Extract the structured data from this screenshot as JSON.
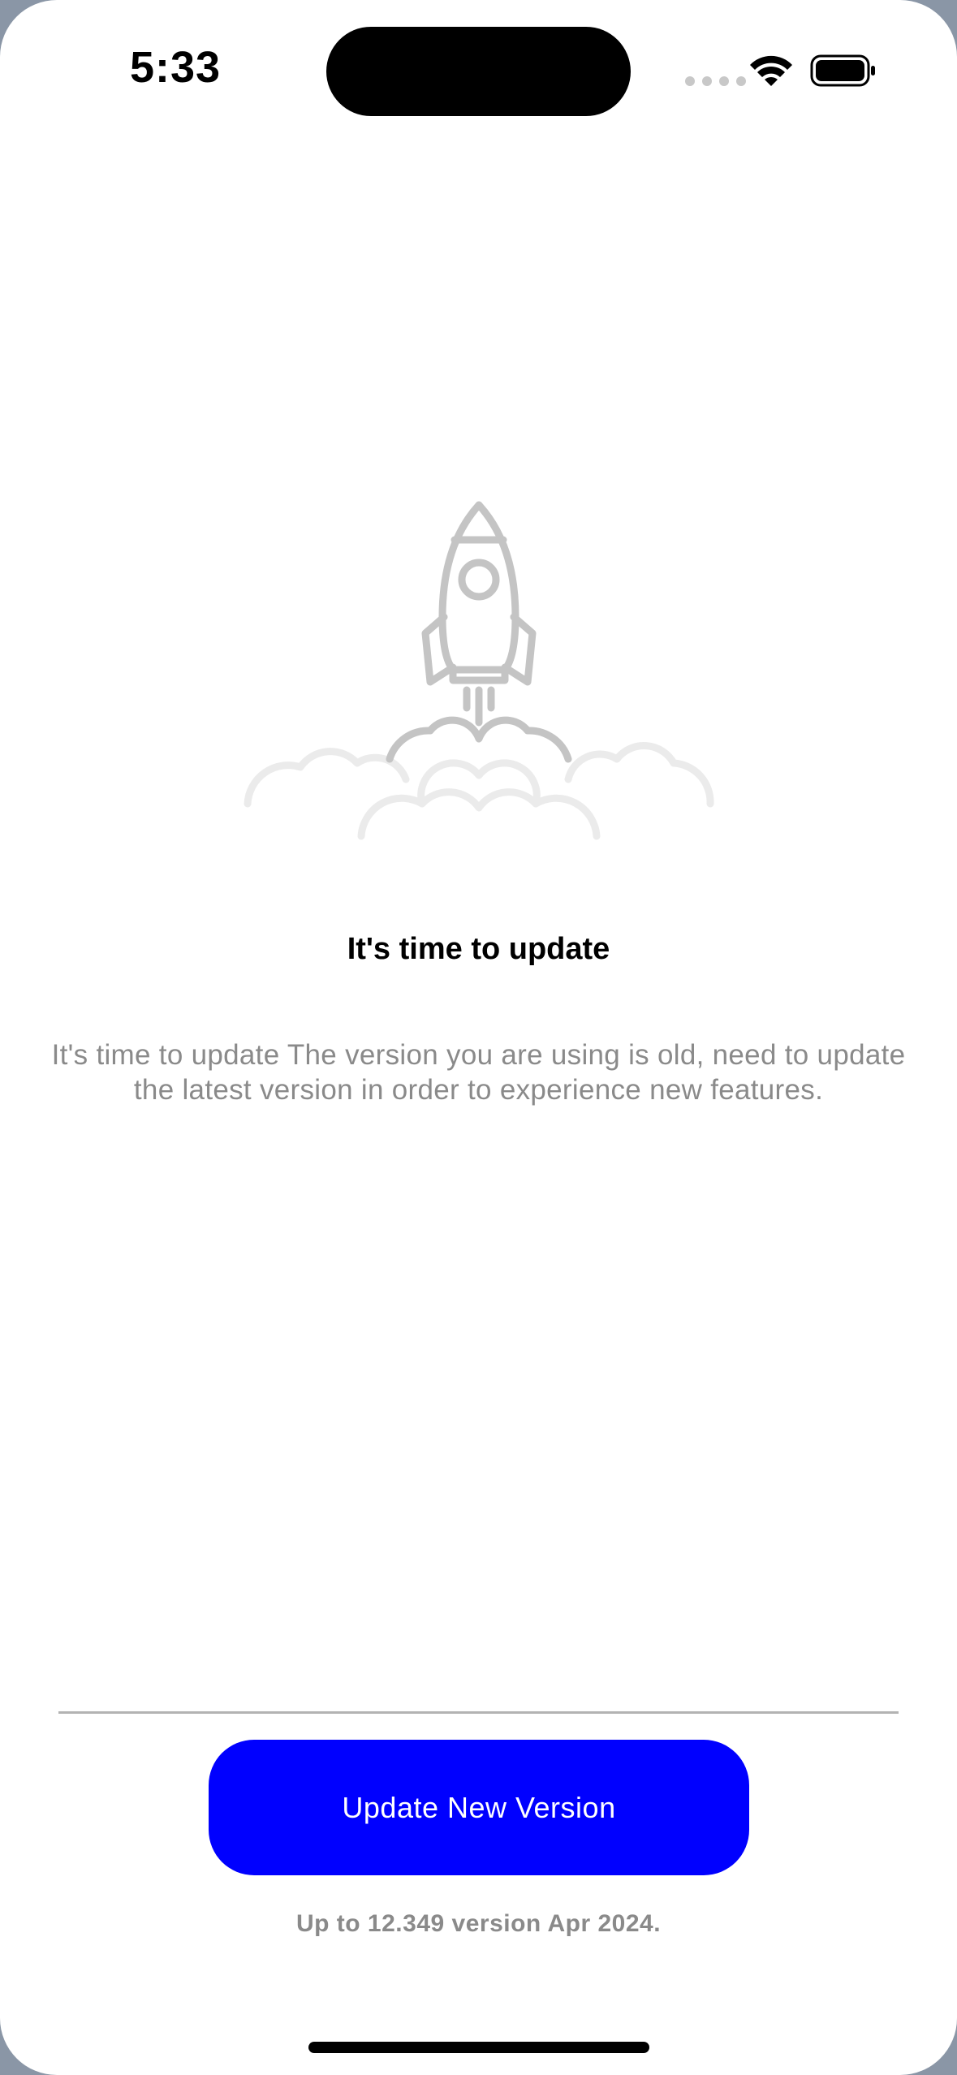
{
  "status_bar": {
    "time": "5:33",
    "icons": [
      "cellular-signal-icon",
      "wifi-icon",
      "battery-icon"
    ]
  },
  "illustration": {
    "icon": "rocket-launch-icon"
  },
  "content": {
    "title": "It's time to update",
    "description": "It's time to update The version you are using is old, need to update the latest version in order to experience new features."
  },
  "footer": {
    "button_label": "Update New Version",
    "version_note": "Up to 12.349 version Apr 2024."
  },
  "colors": {
    "accent": "#0000ff",
    "muted_text": "#8a8a8a",
    "illustration_gray": "#c4c4c4"
  }
}
